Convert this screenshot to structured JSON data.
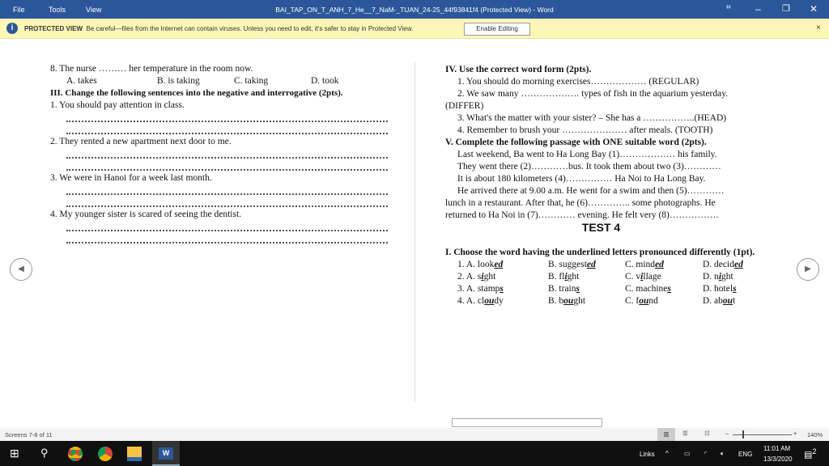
{
  "titlebar": {
    "menu": [
      "File",
      "Tools",
      "View"
    ],
    "title": "BAI_TAP_ON_T_ANH_7_He__7_NaM-_TUAN_24-25_44f93841f4 (Protected View) - Word"
  },
  "protected": {
    "label": "PROTECTED VIEW",
    "message": "Be careful—files from the Internet can contain viruses. Unless you need to edit, it's safer to stay in Protected View.",
    "button": "Enable Editing",
    "close": "×"
  },
  "left": {
    "q8": "8. The nurse ……… her temperature in the room now.",
    "q8_opts": [
      "A. takes",
      "B. is taking",
      "C. taking",
      "D. took"
    ],
    "sec3": "III. Change the following sentences into the negative and interrogative (2pts).",
    "items": [
      "1. You should pay attention in class.",
      "2. They rented a new apartment next door to me.",
      "3. We were in Hanoi for a week last month.",
      "4. My younger sister is scared of seeing the dentist."
    ]
  },
  "right": {
    "sec4": "IV. Use the correct word form (2pts).",
    "wf": [
      "1. You should do morning exercises……………… (REGULAR)",
      "2. We saw many ………………. types of fish in the aquarium yesterday.",
      "(DIFFER)",
      "3. What's the matter with your sister? – She has a ……………..(HEAD)",
      "4. Remember to brush your ………………… after meals. (TOOTH)"
    ],
    "sec5": "V. Complete the following passage with ONE suitable word (2pts).",
    "passage": [
      "Last weekend, Ba went to Ha Long Bay (1)……………… his family.",
      "They went there (2)…………bus. It took them about two (3)…………",
      "It is about 180 kilometers (4)…………… Ha Noi to Ha Long Bay.",
      "He arrived there at 9.00 a.m. He went for a swim and then (5)…………",
      "lunch in a restaurant. After that, he (6)………….. some photographs. He",
      "returned to Ha Noi in (7)………… evening. He felt very (8)……………."
    ],
    "test": "TEST 4",
    "sec1": "I. Choose the word having the underlined letters pronounced differently (1pt).",
    "rows": [
      [
        {
          "p": "1. A. look",
          "u": "ed",
          "s": ""
        },
        {
          "p": "B. suggest",
          "u": "ed",
          "s": ""
        },
        {
          "p": "C. mind",
          "u": "ed",
          "s": ""
        },
        {
          "p": "D. decid",
          "u": "ed",
          "s": ""
        }
      ],
      [
        {
          "p": "2. A. s",
          "u": "i",
          "s": "ght"
        },
        {
          "p": "B. fl",
          "u": "i",
          "s": "ght"
        },
        {
          "p": "C. v",
          "u": "i",
          "s": "llage"
        },
        {
          "p": "D. n",
          "u": "i",
          "s": "ght"
        }
      ],
      [
        {
          "p": "3. A. stamp",
          "u": "s",
          "s": ""
        },
        {
          "p": "B. train",
          "u": "s",
          "s": ""
        },
        {
          "p": "C. machine",
          "u": "s",
          "s": ""
        },
        {
          "p": "D. hotel",
          "u": "s",
          "s": ""
        }
      ],
      [
        {
          "p": "4. A. cl",
          "u": "ou",
          "s": "dy"
        },
        {
          "p": "B. b",
          "u": "ou",
          "s": "ght"
        },
        {
          "p": "C. f",
          "u": "ou",
          "s": "nd"
        },
        {
          "p": "D. ab",
          "u": "ou",
          "s": "t"
        }
      ]
    ]
  },
  "status": {
    "screens": "Screens 7-8 of 11",
    "zoom": "140%"
  },
  "taskbar": {
    "links": "Links",
    "lang": "ENG",
    "time": "11:01 AM",
    "date": "13/3/2020",
    "notif": "2"
  }
}
